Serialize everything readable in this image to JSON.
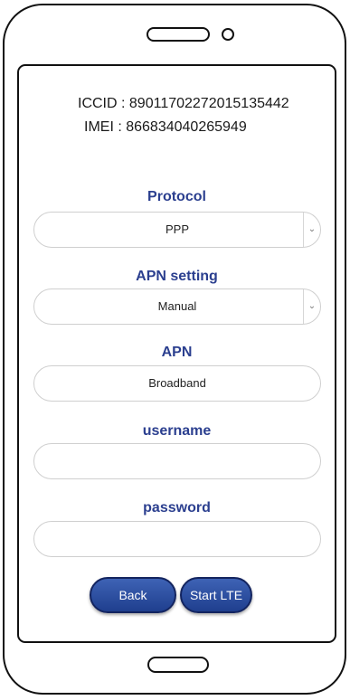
{
  "device": {
    "speaker_icon": "speaker-slot",
    "camera_icon": "camera-dot",
    "home_icon": "home-pill"
  },
  "info": {
    "iccid_label": "ICCID :",
    "iccid_value": "89011702272015135442",
    "imei_label": "IMEI :",
    "imei_value": "866834040265949"
  },
  "form": {
    "protocol_label": "Protocol",
    "protocol_value": "PPP",
    "apn_setting_label": "APN setting",
    "apn_setting_value": "Manual",
    "apn_label": "APN",
    "apn_value": "Broadband",
    "username_label": "username",
    "username_value": "",
    "password_label": "password",
    "password_value": ""
  },
  "buttons": {
    "back_label": "Back",
    "start_label": "Start LTE"
  },
  "colors": {
    "label": "#2b3f8f",
    "button": "#2a4c9f"
  }
}
